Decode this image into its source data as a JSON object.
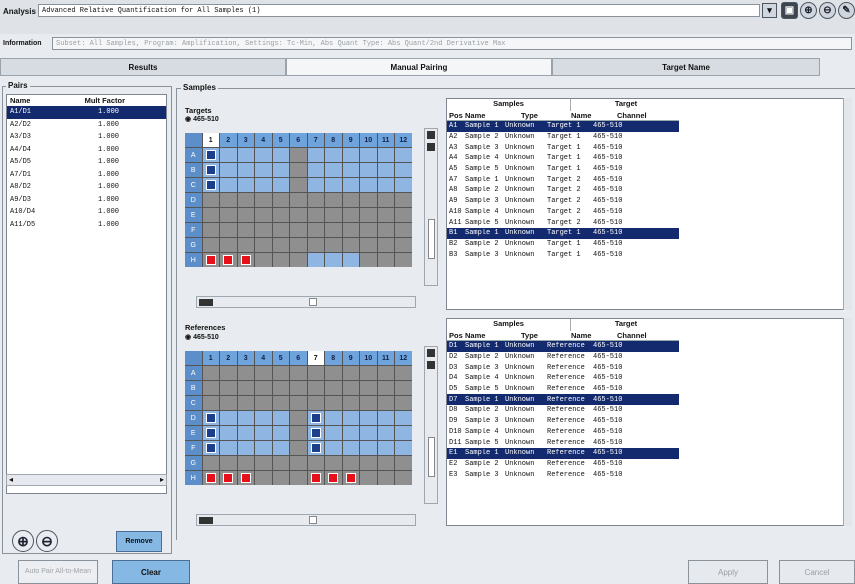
{
  "header": {
    "analysis_label": "Analysis",
    "analysis_value": "Advanced Relative Quantification for All Samples (1)",
    "info_label": "Information",
    "info_value": "Subset: All Samples, Program: Amplification, Settings: Tc-Min, Abs Quant Type: Abs Quant/2nd Derivative Max"
  },
  "tabs": [
    {
      "label": "Results"
    },
    {
      "label": "Manual Pairing"
    },
    {
      "label": "Target Name"
    }
  ],
  "pairs": {
    "title": "Pairs",
    "col_name": "Name",
    "col_factor": "Mult Factor",
    "rows": [
      {
        "name": "A1/D1",
        "factor": "1.000",
        "selected": true
      },
      {
        "name": "A2/D2",
        "factor": "1.000"
      },
      {
        "name": "A3/D3",
        "factor": "1.000"
      },
      {
        "name": "A4/D4",
        "factor": "1.000"
      },
      {
        "name": "A5/D5",
        "factor": "1.000"
      },
      {
        "name": "A7/D1",
        "factor": "1.000"
      },
      {
        "name": "A8/D2",
        "factor": "1.000"
      },
      {
        "name": "A9/D3",
        "factor": "1.000"
      },
      {
        "name": "A10/D4",
        "factor": "1.000"
      },
      {
        "name": "A11/D5",
        "factor": "1.000"
      }
    ],
    "remove_label": "Remove",
    "auto_pair_label": "Auto Pair All-to-Mean",
    "clear_label": "Clear"
  },
  "samples_legend": "Samples",
  "targets": {
    "title": "Targets",
    "channel": "465-510",
    "columns": [
      "1",
      "2",
      "3",
      "4",
      "5",
      "6",
      "7",
      "8",
      "9",
      "10",
      "11",
      "12"
    ],
    "rows": [
      "A",
      "B",
      "C",
      "D",
      "E",
      "F",
      "G",
      "H"
    ]
  },
  "references": {
    "title": "References",
    "channel": "465-510",
    "columns": [
      "1",
      "2",
      "3",
      "4",
      "5",
      "6",
      "7",
      "8",
      "9",
      "10",
      "11",
      "12"
    ],
    "rows": [
      "A",
      "B",
      "C",
      "D",
      "E",
      "F",
      "G",
      "H"
    ]
  },
  "table_headers": {
    "samples": "Samples",
    "target": "Target",
    "pos": "Pos",
    "name": "Name",
    "type": "Type",
    "tname": "Name",
    "channel": "Channel"
  },
  "targets_table": [
    {
      "pos": "A1",
      "name": "Sample 1",
      "type": "Unknown",
      "tname": "Target 1",
      "channel": "465-510",
      "selected": true
    },
    {
      "pos": "A2",
      "name": "Sample 2",
      "type": "Unknown",
      "tname": "Target 1",
      "channel": "465-510"
    },
    {
      "pos": "A3",
      "name": "Sample 3",
      "type": "Unknown",
      "tname": "Target 1",
      "channel": "465-510"
    },
    {
      "pos": "A4",
      "name": "Sample 4",
      "type": "Unknown",
      "tname": "Target 1",
      "channel": "465-510"
    },
    {
      "pos": "A5",
      "name": "Sample 5",
      "type": "Unknown",
      "tname": "Target 1",
      "channel": "465-510"
    },
    {
      "pos": "A7",
      "name": "Sample 1",
      "type": "Unknown",
      "tname": "Target 2",
      "channel": "465-510"
    },
    {
      "pos": "A8",
      "name": "Sample 2",
      "type": "Unknown",
      "tname": "Target 2",
      "channel": "465-510"
    },
    {
      "pos": "A9",
      "name": "Sample 3",
      "type": "Unknown",
      "tname": "Target 2",
      "channel": "465-510"
    },
    {
      "pos": "A10",
      "name": "Sample 4",
      "type": "Unknown",
      "tname": "Target 2",
      "channel": "465-510"
    },
    {
      "pos": "A11",
      "name": "Sample 5",
      "type": "Unknown",
      "tname": "Target 2",
      "channel": "465-510"
    },
    {
      "pos": "B1",
      "name": "Sample 1",
      "type": "Unknown",
      "tname": "Target 1",
      "channel": "465-510",
      "selected": true
    },
    {
      "pos": "B2",
      "name": "Sample 2",
      "type": "Unknown",
      "tname": "Target 1",
      "channel": "465-510"
    },
    {
      "pos": "B3",
      "name": "Sample 3",
      "type": "Unknown",
      "tname": "Target 1",
      "channel": "465-510"
    }
  ],
  "references_table": [
    {
      "pos": "D1",
      "name": "Sample 1",
      "type": "Unknown",
      "tname": "Reference",
      "channel": "465-510",
      "selected": true
    },
    {
      "pos": "D2",
      "name": "Sample 2",
      "type": "Unknown",
      "tname": "Reference",
      "channel": "465-510"
    },
    {
      "pos": "D3",
      "name": "Sample 3",
      "type": "Unknown",
      "tname": "Reference",
      "channel": "465-510"
    },
    {
      "pos": "D4",
      "name": "Sample 4",
      "type": "Unknown",
      "tname": "Reference",
      "channel": "465-510"
    },
    {
      "pos": "D5",
      "name": "Sample 5",
      "type": "Unknown",
      "tname": "Reference",
      "channel": "465-510"
    },
    {
      "pos": "D7",
      "name": "Sample 1",
      "type": "Unknown",
      "tname": "Reference",
      "channel": "465-510",
      "selected": true
    },
    {
      "pos": "D8",
      "name": "Sample 2",
      "type": "Unknown",
      "tname": "Reference",
      "channel": "465-510"
    },
    {
      "pos": "D9",
      "name": "Sample 3",
      "type": "Unknown",
      "tname": "Reference",
      "channel": "465-510"
    },
    {
      "pos": "D10",
      "name": "Sample 4",
      "type": "Unknown",
      "tname": "Reference",
      "channel": "465-510"
    },
    {
      "pos": "D11",
      "name": "Sample 5",
      "type": "Unknown",
      "tname": "Reference",
      "channel": "465-510"
    },
    {
      "pos": "E1",
      "name": "Sample 1",
      "type": "Unknown",
      "tname": "Reference",
      "channel": "465-510",
      "selected": true
    },
    {
      "pos": "E2",
      "name": "Sample 2",
      "type": "Unknown",
      "tname": "Reference",
      "channel": "465-510"
    },
    {
      "pos": "E3",
      "name": "Sample 3",
      "type": "Unknown",
      "tname": "Reference",
      "channel": "465-510"
    }
  ],
  "footer": {
    "apply_label": "Apply",
    "cancel_label": "Cancel"
  },
  "colors": {
    "selection": "#132b6e",
    "well_light_blue": "#8fb6e3",
    "well_gray": "#8f8f8f",
    "marker_blue": "#1d3e8c",
    "marker_red": "#e5101a",
    "clear_button": "#86b8e4"
  }
}
